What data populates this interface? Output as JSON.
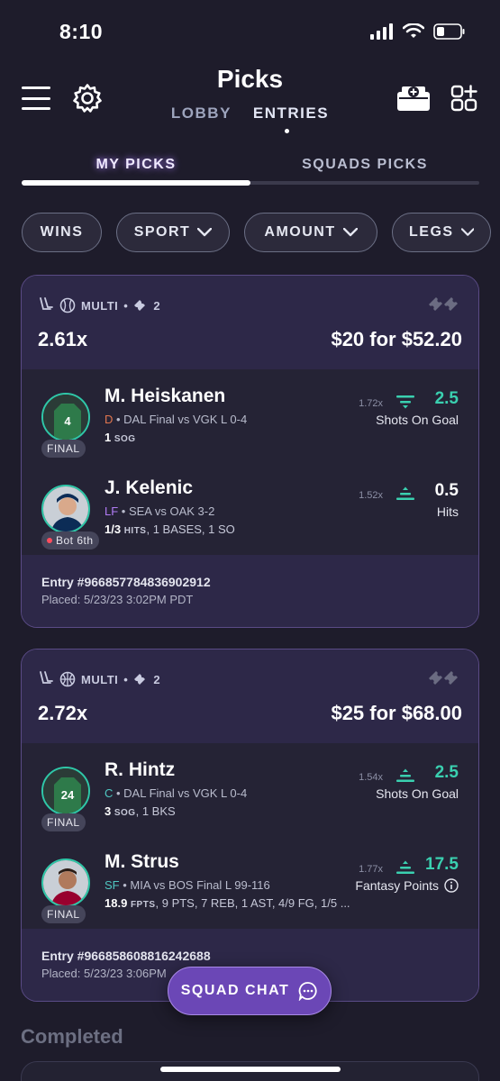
{
  "status_bar": {
    "time": "8:10"
  },
  "header": {
    "title": "Picks",
    "tabs": [
      {
        "label": "LOBBY"
      },
      {
        "label": "ENTRIES"
      }
    ]
  },
  "subtabs": [
    {
      "label": "MY PICKS"
    },
    {
      "label": "SQUADS PICKS"
    }
  ],
  "filters": [
    {
      "label": "WINS",
      "has_chevron": false
    },
    {
      "label": "SPORT",
      "has_chevron": true
    },
    {
      "label": "AMOUNT",
      "has_chevron": true
    },
    {
      "label": "LEGS",
      "has_chevron": true
    }
  ],
  "entries": [
    {
      "type_label": "MULTI",
      "legs": "2",
      "multiplier": "2.61x",
      "payout": "$20 for $52.20",
      "picks": [
        {
          "name": "M. Heiskanen",
          "position": "D",
          "meta": " • DAL Final vs VGK L 0-4",
          "stat_value": "1",
          "stat_unit": "SOG",
          "stat_rest": "",
          "badge": "FINAL",
          "jersey_number": "4",
          "mult": "1.72x",
          "direction": "lower",
          "line": "2.5",
          "category": "Shots On Goal"
        },
        {
          "name": "J. Kelenic",
          "position": "LF",
          "meta": " • SEA vs OAK 3-2",
          "stat_value": "1/3",
          "stat_unit": "HITS",
          "stat_rest": ", 1 BASES, 1 SO",
          "badge": "Bot 6th",
          "mult": "1.52x",
          "direction": "higher",
          "line": "0.5",
          "category": "Hits"
        }
      ],
      "entry_id": "Entry #966857784836902912",
      "placed": "Placed: 5/23/23 3:02PM PDT"
    },
    {
      "type_label": "MULTI",
      "legs": "2",
      "multiplier": "2.72x",
      "payout": "$25 for $68.00",
      "picks": [
        {
          "name": "R. Hintz",
          "position": "C",
          "meta": " • DAL Final vs VGK L 0-4",
          "stat_value": "3",
          "stat_unit": "SOG",
          "stat_rest": ", 1 BKS",
          "badge": "FINAL",
          "jersey_number": "24",
          "mult": "1.54x",
          "direction": "higher",
          "line": "2.5",
          "category": "Shots On Goal"
        },
        {
          "name": "M. Strus",
          "position": "SF",
          "meta": " • MIA vs BOS Final L 99-116",
          "stat_value": "18.9",
          "stat_unit": "FPTS",
          "stat_rest": ", 9 PTS, 7 REB, 1 AST, 4/9 FG, 1/5 ...",
          "badge": "FINAL",
          "mult": "1.77x",
          "direction": "higher",
          "line": "17.5",
          "category": "Fantasy Points"
        }
      ],
      "entry_id": "Entry #966858608816242688",
      "placed": "Placed: 5/23/23 3:06PM"
    }
  ],
  "squad_chat": {
    "label": "SQUAD CHAT"
  },
  "completed_label": "Completed",
  "colors": {
    "accent": "#3ad0b0",
    "purple": "#6b47b6",
    "background": "#1e1c2b"
  }
}
